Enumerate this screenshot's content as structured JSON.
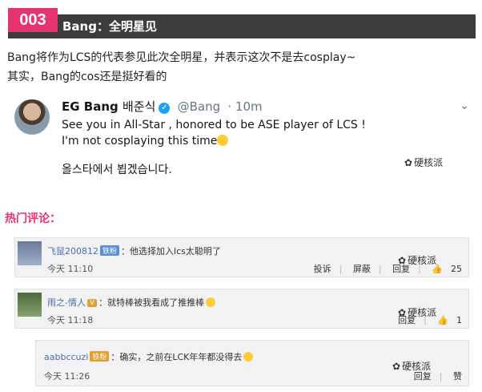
{
  "header": {
    "number": "003",
    "title": "Bang：全明星见"
  },
  "intro": [
    "Bang将作为LCS的代表参见此次全明星，并表示这次不是去cosplay~",
    "其实，Bang的cos还是挺好看的"
  ],
  "tweet": {
    "name": "EG Bang",
    "korean_name": "배준식",
    "handle": "@Bang",
    "time": "· 10m",
    "line1": "See you in All-Star , honored to be   ASE player of LCS !",
    "line2": "I'm not cosplaying this time",
    "line3": "올스타에서 뵙겠습니다.",
    "caret": "⌄"
  },
  "watermark": "硬核派",
  "hot_title": "热门评论：",
  "comments": [
    {
      "user": "飞鼠200812",
      "badge": "铁粉",
      "text": "：他选择加入lcs太聪明了",
      "time": "今天 11:10",
      "actions": [
        "投诉",
        "屏蔽",
        "回复"
      ],
      "likes": "25"
    },
    {
      "user": "雨之-情人",
      "badge": "",
      "text": "：就特棒被我看成了推推棒",
      "time": "今天 11:18",
      "actions": [
        "回复"
      ],
      "likes": "1"
    },
    {
      "user": "aabbccuzi",
      "badge": "铁粉",
      "text": "：确实，之前在LCK年年都没得去",
      "time": "今天 11:26",
      "actions": [
        "回复"
      ],
      "likes": "赞"
    }
  ],
  "colors": {
    "accent": "#e8336f",
    "header_bg": "#3c3c3c",
    "twitter_blue": "#1da1f2"
  }
}
